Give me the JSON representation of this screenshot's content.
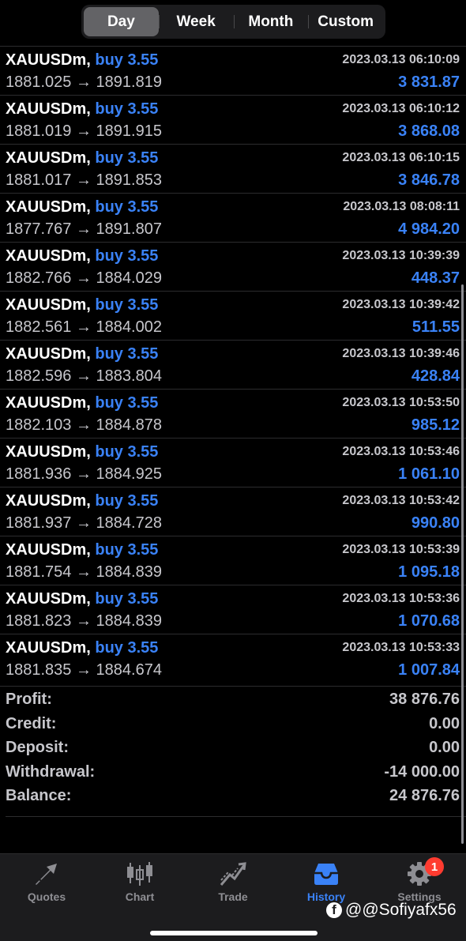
{
  "periods": [
    "Day",
    "Week",
    "Month",
    "Custom"
  ],
  "active_period": "Day",
  "trades": [
    {
      "symbol": "XAUUSDm,",
      "side": "buy",
      "volume": "3.55",
      "time": "2023.03.13 06:10:09",
      "open": "1881.025",
      "close": "1891.819",
      "profit": "3 831.87"
    },
    {
      "symbol": "XAUUSDm,",
      "side": "buy",
      "volume": "3.55",
      "time": "2023.03.13 06:10:12",
      "open": "1881.019",
      "close": "1891.915",
      "profit": "3 868.08"
    },
    {
      "symbol": "XAUUSDm,",
      "side": "buy",
      "volume": "3.55",
      "time": "2023.03.13 06:10:15",
      "open": "1881.017",
      "close": "1891.853",
      "profit": "3 846.78"
    },
    {
      "symbol": "XAUUSDm,",
      "side": "buy",
      "volume": "3.55",
      "time": "2023.03.13 08:08:11",
      "open": "1877.767",
      "close": "1891.807",
      "profit": "4 984.20"
    },
    {
      "symbol": "XAUUSDm,",
      "side": "buy",
      "volume": "3.55",
      "time": "2023.03.13 10:39:39",
      "open": "1882.766",
      "close": "1884.029",
      "profit": "448.37"
    },
    {
      "symbol": "XAUUSDm,",
      "side": "buy",
      "volume": "3.55",
      "time": "2023.03.13 10:39:42",
      "open": "1882.561",
      "close": "1884.002",
      "profit": "511.55"
    },
    {
      "symbol": "XAUUSDm,",
      "side": "buy",
      "volume": "3.55",
      "time": "2023.03.13 10:39:46",
      "open": "1882.596",
      "close": "1883.804",
      "profit": "428.84"
    },
    {
      "symbol": "XAUUSDm,",
      "side": "buy",
      "volume": "3.55",
      "time": "2023.03.13 10:53:50",
      "open": "1882.103",
      "close": "1884.878",
      "profit": "985.12"
    },
    {
      "symbol": "XAUUSDm,",
      "side": "buy",
      "volume": "3.55",
      "time": "2023.03.13 10:53:46",
      "open": "1881.936",
      "close": "1884.925",
      "profit": "1 061.10"
    },
    {
      "symbol": "XAUUSDm,",
      "side": "buy",
      "volume": "3.55",
      "time": "2023.03.13 10:53:42",
      "open": "1881.937",
      "close": "1884.728",
      "profit": "990.80"
    },
    {
      "symbol": "XAUUSDm,",
      "side": "buy",
      "volume": "3.55",
      "time": "2023.03.13 10:53:39",
      "open": "1881.754",
      "close": "1884.839",
      "profit": "1 095.18"
    },
    {
      "symbol": "XAUUSDm,",
      "side": "buy",
      "volume": "3.55",
      "time": "2023.03.13 10:53:36",
      "open": "1881.823",
      "close": "1884.839",
      "profit": "1 070.68"
    },
    {
      "symbol": "XAUUSDm,",
      "side": "buy",
      "volume": "3.55",
      "time": "2023.03.13 10:53:33",
      "open": "1881.835",
      "close": "1884.674",
      "profit": "1 007.84"
    }
  ],
  "arrow": "→",
  "summary": [
    {
      "label": "Profit:",
      "value": "38 876.76"
    },
    {
      "label": "Credit:",
      "value": "0.00"
    },
    {
      "label": "Deposit:",
      "value": "0.00"
    },
    {
      "label": "Withdrawal:",
      "value": "-14 000.00"
    },
    {
      "label": "Balance:",
      "value": "24 876.76"
    }
  ],
  "tabs": [
    {
      "label": "Quotes",
      "icon": "quotes-arrows-icon"
    },
    {
      "label": "Chart",
      "icon": "candlestick-icon"
    },
    {
      "label": "Trade",
      "icon": "trade-trend-icon"
    },
    {
      "label": "History",
      "icon": "inbox-tray-icon"
    },
    {
      "label": "Settings",
      "icon": "gear-icon"
    }
  ],
  "active_tab": "History",
  "settings_badge": "1",
  "watermark": "@@Sofiyafx56",
  "colors": {
    "accent": "#3a82f7",
    "badge": "#ff3b30",
    "background": "#000000"
  }
}
